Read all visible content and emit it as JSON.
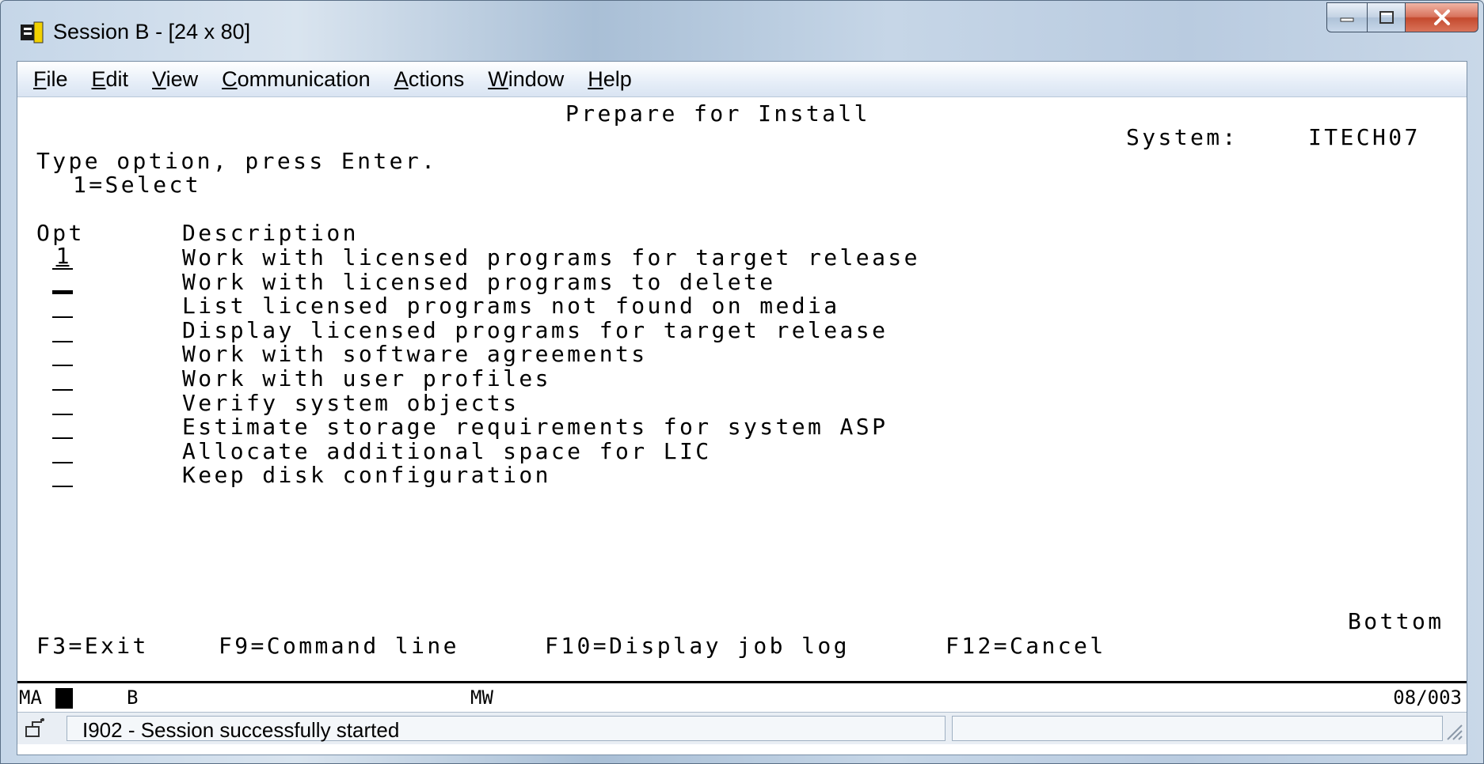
{
  "window": {
    "title": "Session B - [24 x 80]"
  },
  "menu": [
    {
      "label": "File",
      "key": "F"
    },
    {
      "label": "Edit",
      "key": "E"
    },
    {
      "label": "View",
      "key": "V"
    },
    {
      "label": "Communication",
      "key": "C"
    },
    {
      "label": "Actions",
      "key": "A"
    },
    {
      "label": "Window",
      "key": "W"
    },
    {
      "label": "Help",
      "key": "H"
    }
  ],
  "screen": {
    "heading": "Prepare for Install",
    "system_label": "System:",
    "system_name": "ITECH07",
    "instruction": "Type option, press Enter.",
    "option_legend": "1=Select",
    "col_opt": "Opt",
    "col_description": "Description",
    "rows": [
      {
        "opt": "1",
        "description": "Work with licensed programs for target release"
      },
      {
        "opt": "",
        "description": "Work with licensed programs to delete"
      },
      {
        "opt": "",
        "description": "List licensed programs not found on media"
      },
      {
        "opt": "",
        "description": "Display licensed programs for target release"
      },
      {
        "opt": "",
        "description": "Work with software agreements"
      },
      {
        "opt": "",
        "description": "Work with user profiles"
      },
      {
        "opt": "",
        "description": "Verify system objects"
      },
      {
        "opt": "",
        "description": "Estimate storage requirements for system ASP"
      },
      {
        "opt": "",
        "description": "Allocate additional space for LIC"
      },
      {
        "opt": "",
        "description": "Keep disk configuration"
      }
    ],
    "more_indicator": "Bottom",
    "function_keys": [
      "F3=Exit",
      "F9=Command line",
      "F10=Display job log",
      "F12=Cancel"
    ]
  },
  "oia": {
    "indicator": "MA",
    "session": "B",
    "mode": "MW",
    "cursor_pos": "08/003"
  },
  "status": {
    "message": "I902 - Session successfully started"
  },
  "icons": {
    "app": "session-terminal-icon",
    "minimize": "minimize-icon",
    "maximize": "maximize-icon",
    "close": "close-icon",
    "status": "comm-status-icon"
  }
}
